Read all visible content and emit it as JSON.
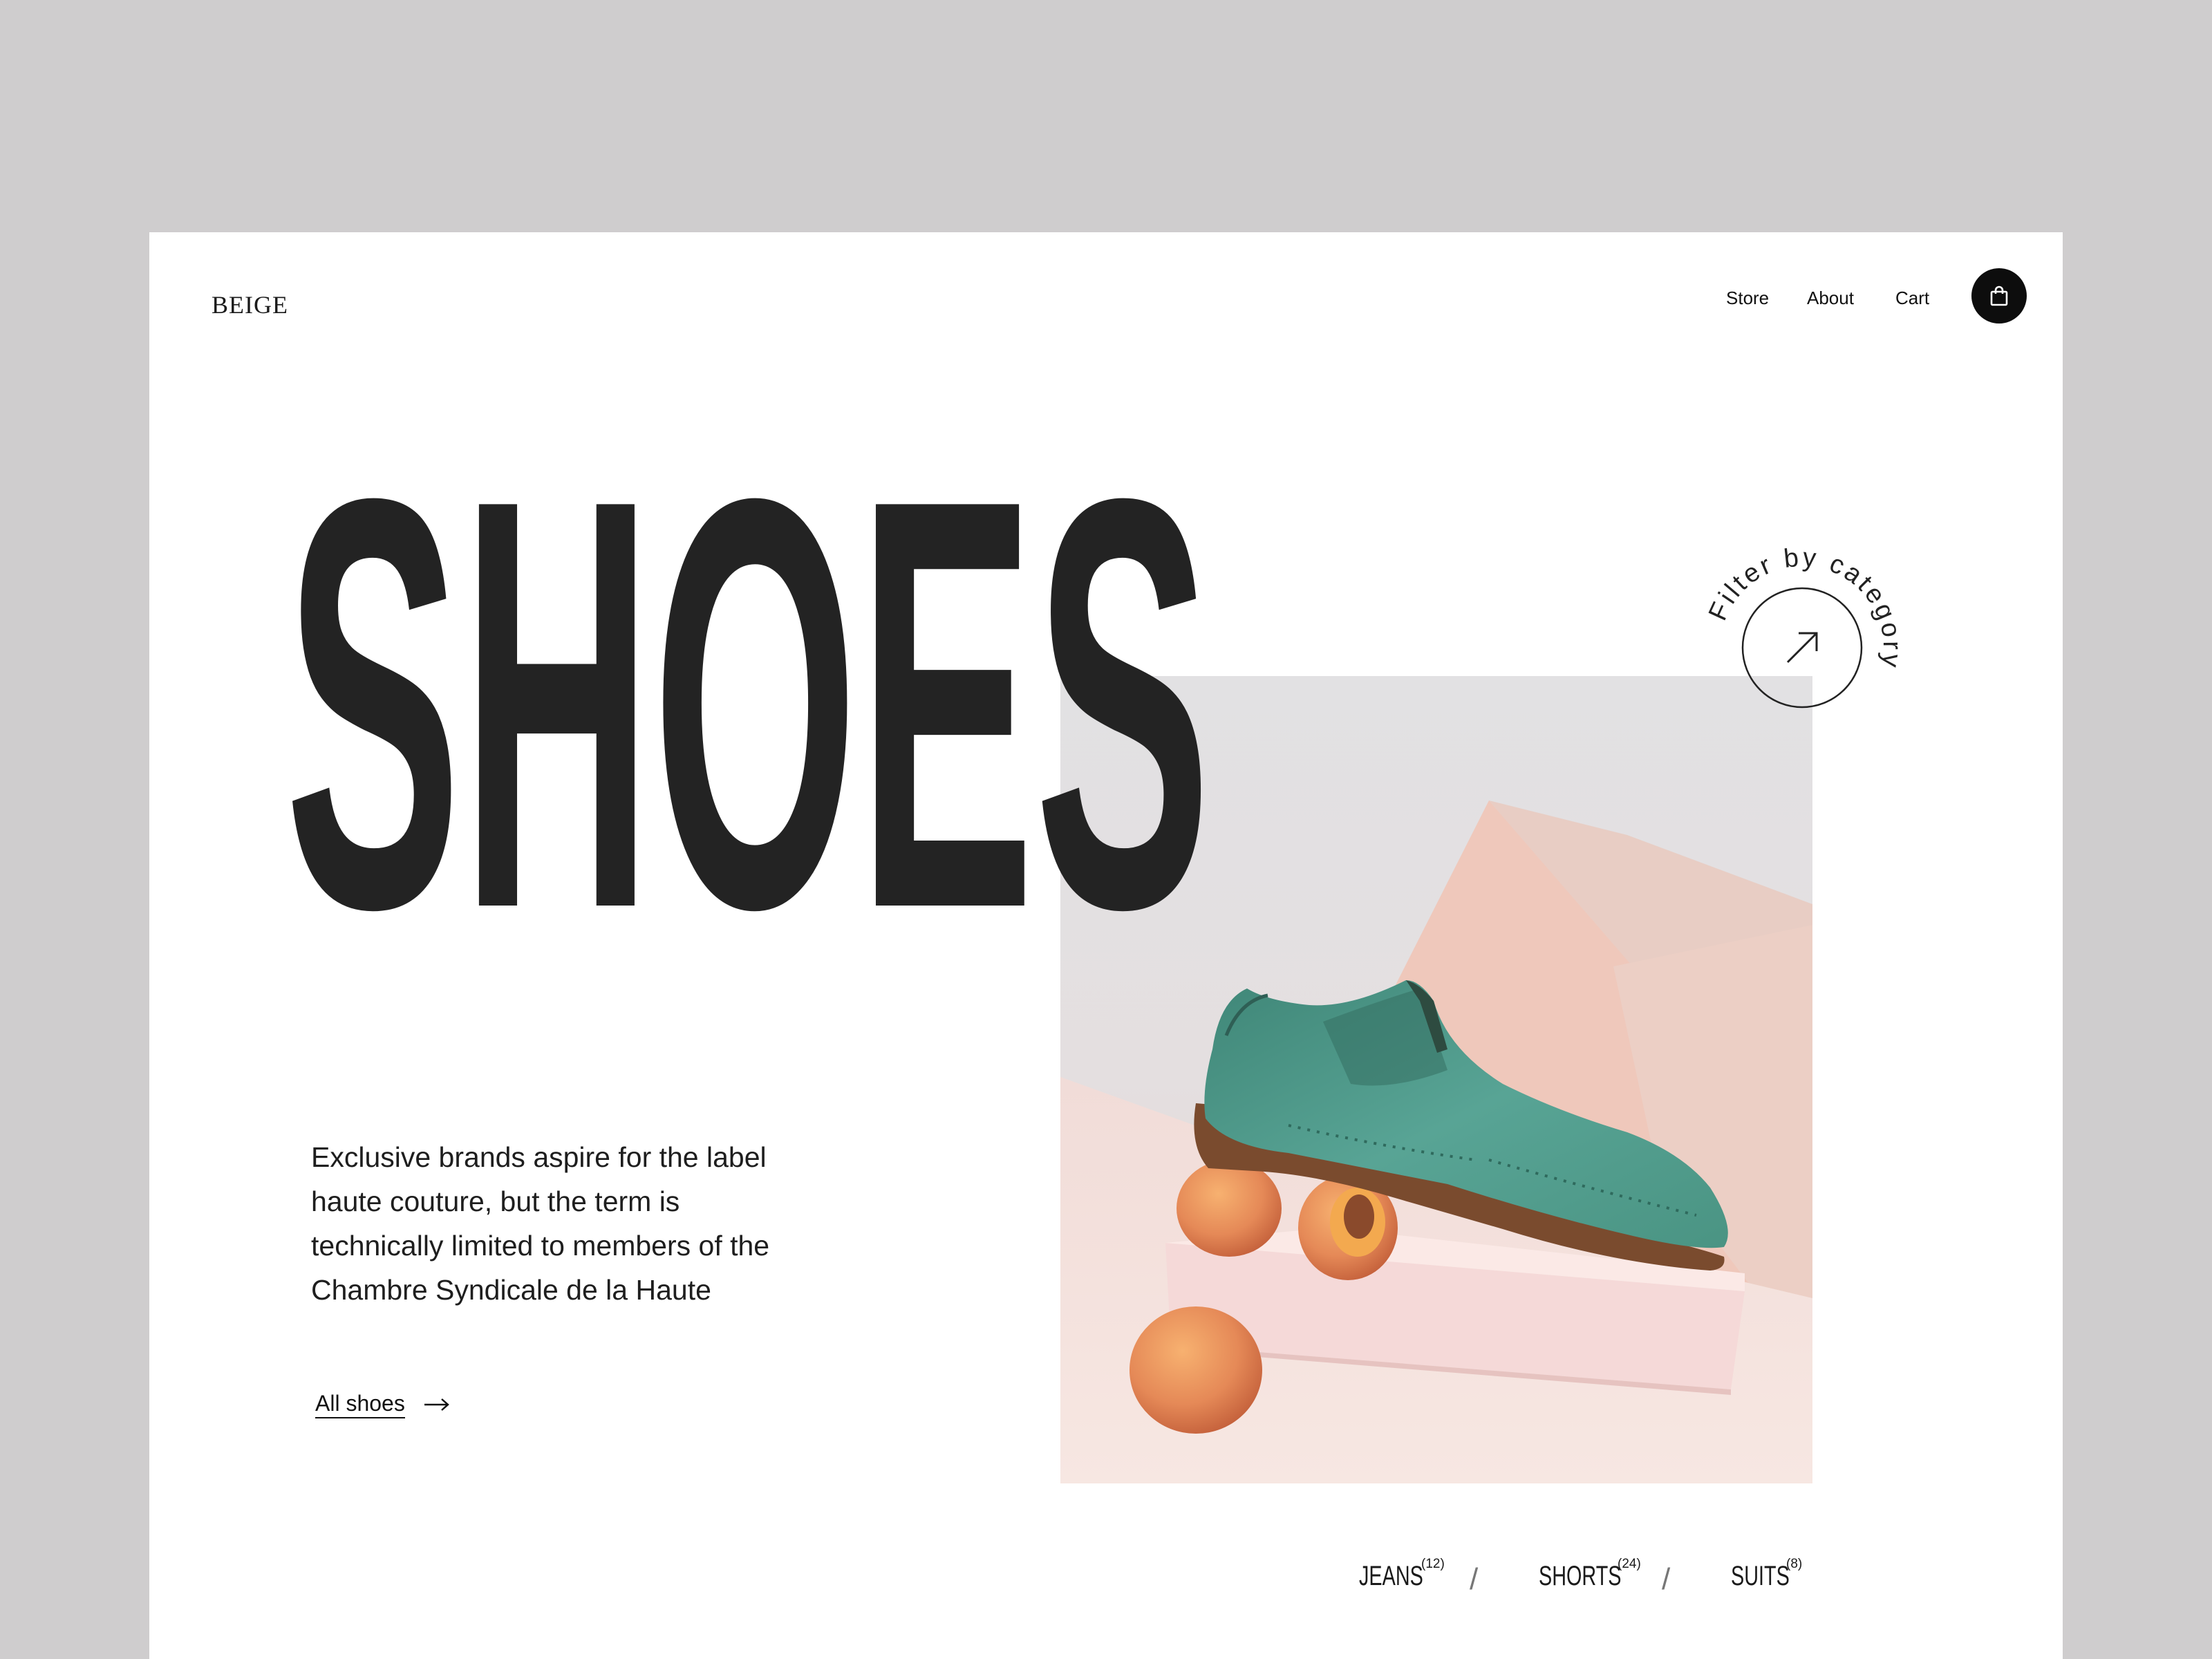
{
  "brand": {
    "logo": "BEIGE"
  },
  "nav": {
    "items": [
      {
        "label": "Store"
      },
      {
        "label": "About"
      },
      {
        "label": "Cart"
      }
    ],
    "cart_icon": "shopping-bag-icon"
  },
  "hero": {
    "title": "SHOES",
    "description_lines": [
      "Exclusive brands aspire for the label",
      "haute couture, but the term is",
      "technically limited to members of the",
      "Chambre Syndicale de la Haute"
    ],
    "cta_label": "All shoes",
    "cta_icon": "arrow-right-icon",
    "image_alt": "teal suede brogue shoe resting on apricots and a pink box"
  },
  "filter": {
    "label": "Filter by category",
    "icon": "arrow-up-right-icon"
  },
  "categories": [
    {
      "name": "JEANS",
      "count": "(12)"
    },
    {
      "name": "SHORTS",
      "count": "(24)"
    },
    {
      "name": "SUITS",
      "count": "(8)"
    }
  ],
  "separator": "/",
  "colors": {
    "page_background": "#cfcdce",
    "card_background": "#ffffff",
    "headline": "#232323",
    "button": "#0d0d0d",
    "shoe": "#4f9a8b"
  }
}
